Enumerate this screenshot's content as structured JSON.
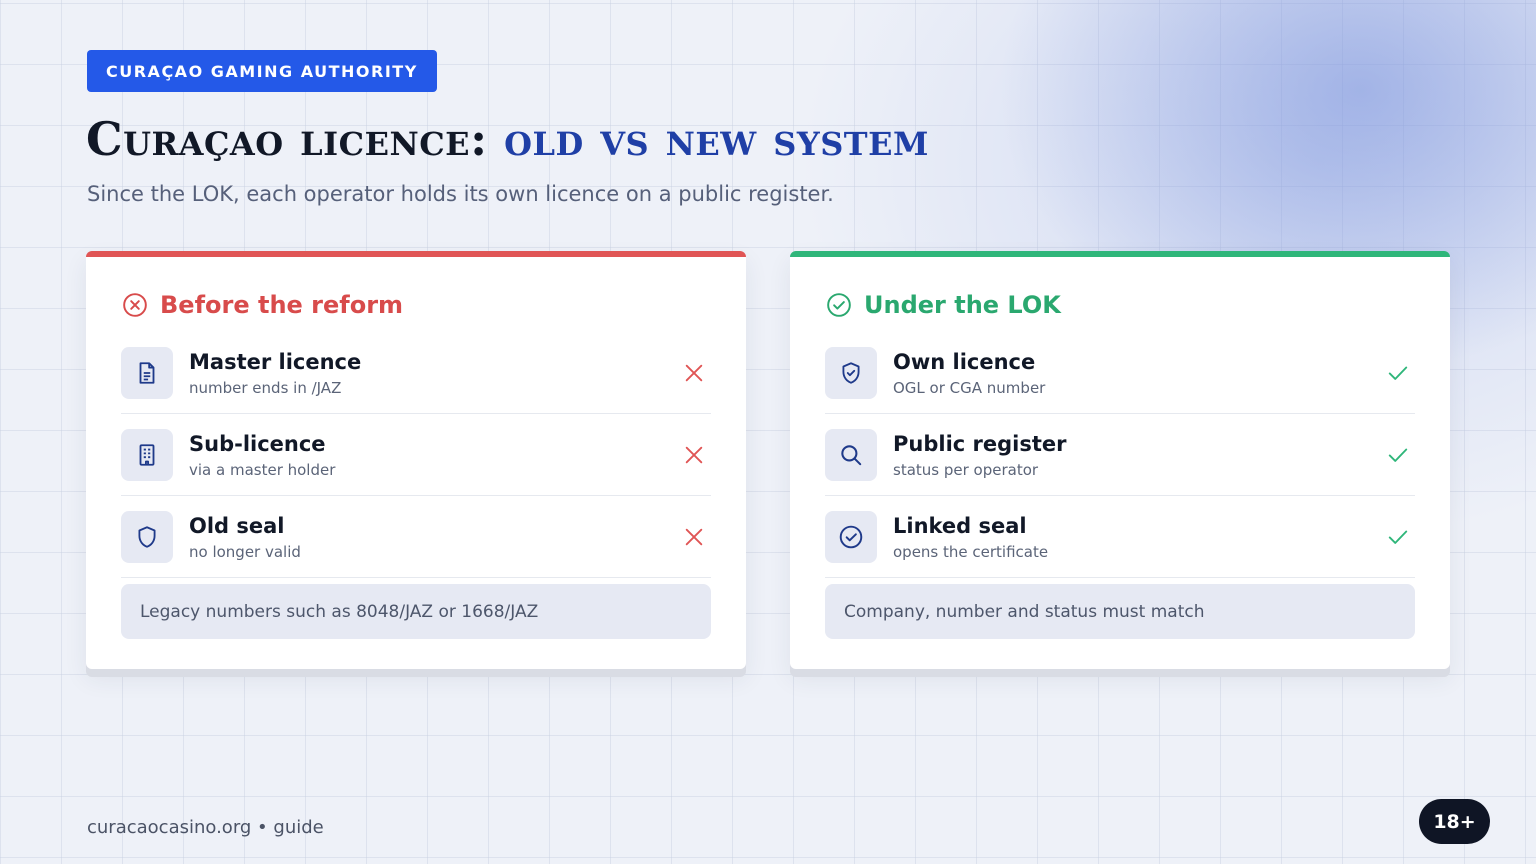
{
  "badge": "CURAÇAO GAMING AUTHORITY",
  "title": {
    "main": "Curaçao licence:",
    "accent": "old vs new system"
  },
  "subtitle": "Since the LOK, each operator holds its own licence on a public register.",
  "colors": {
    "accent_blue": "#2459e8",
    "title_accent": "#1f3fa6",
    "red": "#e05555",
    "green": "#2fb67a"
  },
  "left_card": {
    "heading": "Before the reform",
    "heading_icon": "x-circle-icon",
    "rows": [
      {
        "title": "Master licence",
        "sub": "number ends in /JAZ",
        "icon": "document-icon",
        "mark": "cross-icon"
      },
      {
        "title": "Sub-licence",
        "sub": "via a master holder",
        "icon": "building-icon",
        "mark": "cross-icon"
      },
      {
        "title": "Old seal",
        "sub": "no longer valid",
        "icon": "shield-icon",
        "mark": "cross-icon"
      }
    ],
    "note": "Legacy numbers such as 8048/JAZ or 1668/JAZ"
  },
  "right_card": {
    "heading": "Under the LOK",
    "heading_icon": "check-circle-icon",
    "rows": [
      {
        "title": "Own licence",
        "sub": "OGL or CGA number",
        "icon": "shield-check-icon",
        "mark": "check-icon"
      },
      {
        "title": "Public register",
        "sub": "status per operator",
        "icon": "search-icon",
        "mark": "check-icon"
      },
      {
        "title": "Linked seal",
        "sub": "opens the certificate",
        "icon": "check-circle-icon",
        "mark": "check-icon"
      }
    ],
    "note": "Company, number and status must match"
  },
  "footer": "curacaocasino.org • guide",
  "age_badge": "18+"
}
